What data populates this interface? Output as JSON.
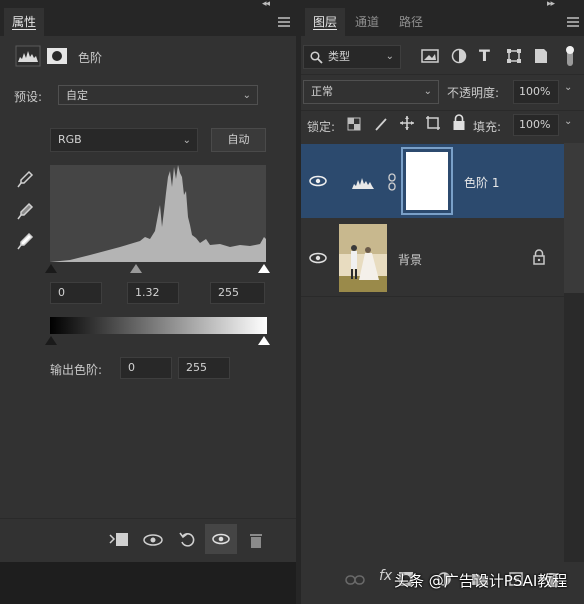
{
  "left_panel": {
    "tab_label": "属性",
    "adjustment_label": "色阶",
    "preset_label": "预设:",
    "preset_value": "自定",
    "channel_value": "RGB",
    "auto_label": "自动",
    "input_black": "0",
    "input_gamma": "1.32",
    "input_white": "255",
    "output_label": "输出色阶:",
    "output_black": "0",
    "output_white": "255",
    "icons": [
      "levels-histogram-icon",
      "layer-mask-icon",
      "eyedropper-black-icon",
      "eyedropper-gray-icon",
      "eyedropper-white-icon",
      "clip-to-layer-icon",
      "view-previous-icon",
      "reset-icon",
      "visibility-eye-icon",
      "trash-icon"
    ]
  },
  "right_panel": {
    "tabs": [
      "图层",
      "通道",
      "路径"
    ],
    "filter_kind": "类型",
    "blend_mode": "正常",
    "opacity_label": "不透明度:",
    "opacity_value": "100%",
    "lock_label": "锁定:",
    "fill_label": "填充:",
    "fill_value": "100%",
    "layers": [
      {
        "name": "色阶 1",
        "selected": true,
        "type": "adjustment"
      },
      {
        "name": "背景",
        "selected": false,
        "type": "image",
        "locked": true
      }
    ],
    "bottom_icons": [
      "link-icon",
      "fx-icon",
      "add-mask-icon",
      "adjustment-icon",
      "group-icon",
      "new-layer-icon",
      "delete-icon"
    ]
  },
  "watermark": "头条 @广告设计PSAI教程",
  "colors": {
    "panel_bg": "#323232",
    "selected_layer": "#2c4a6e",
    "accent_border": "#7aa0c8"
  }
}
